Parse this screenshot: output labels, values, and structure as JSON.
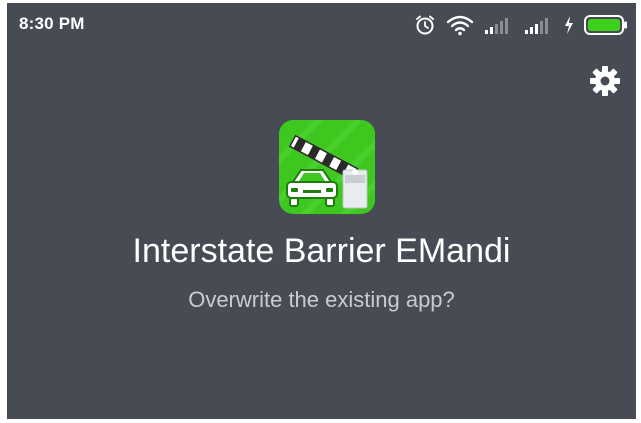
{
  "status_bar": {
    "time": "8:30 PM",
    "icons": [
      "alarm-icon",
      "wifi-icon",
      "signal-icon",
      "signal-icon",
      "charging-icon",
      "battery-icon"
    ],
    "battery_level": 1.0,
    "battery_color": "#3dd11c"
  },
  "toolbar": {
    "settings_icon": "gear-icon"
  },
  "app": {
    "icon": "barrier-car-app-icon",
    "icon_color": "#3ec81f",
    "name": "Interstate Barrier EMandi",
    "prompt": "Overwrite the existing app?"
  },
  "colors": {
    "background": "#474b54",
    "text_primary": "#ffffff",
    "text_secondary": "#c9cbd0"
  }
}
